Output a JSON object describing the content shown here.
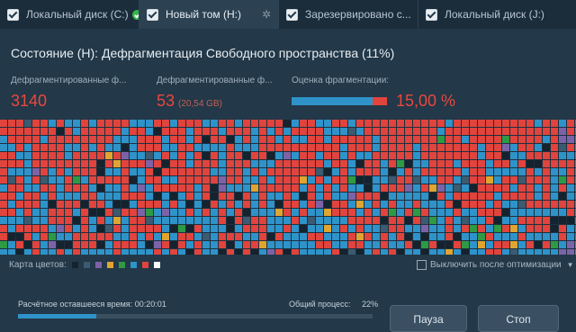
{
  "tabs": [
    {
      "label": "Локальный диск (C:)",
      "status": "ok"
    },
    {
      "label": "Новый том (H:)",
      "active": true
    },
    {
      "label": "Зарезервировано с..."
    },
    {
      "label": "Локальный диск (J:)"
    }
  ],
  "status_title": "Состояние (H): Дефрагментация Свободного пространства (11%)",
  "metrics": {
    "defrag_files_label": "Дефрагментированные ф...",
    "defrag_files_value": "3140",
    "defrag_size_label": "Дефрагментированные ф...",
    "defrag_size_value": "53",
    "defrag_size_sub": "(20,54 GB)",
    "frag_label": "Оценка фрагментации:",
    "frag_value": "15,00 %",
    "frag_fraction": 0.15
  },
  "legend": {
    "label": "Карта цветов:",
    "colors": [
      "#15232e",
      "#3c5a70",
      "#7c63a8",
      "#e0a430",
      "#2e9a44",
      "#2f93c9",
      "#e0443d",
      "#ffffff"
    ]
  },
  "shutdown_label": "Выключить после оптимизации",
  "remaining": {
    "label": "Расчётное оставшееся время:",
    "value": "00:20:01"
  },
  "overall": {
    "label": "Общий процесс:",
    "value": "22%",
    "fraction": 0.22
  },
  "buttons": {
    "pause": "Пауза",
    "stop": "Стоп"
  },
  "colors": {
    "fragmented": "#e0443d",
    "contiguous": "#2f93c9",
    "empty": "#15232e",
    "accent": "#2f93c9"
  }
}
